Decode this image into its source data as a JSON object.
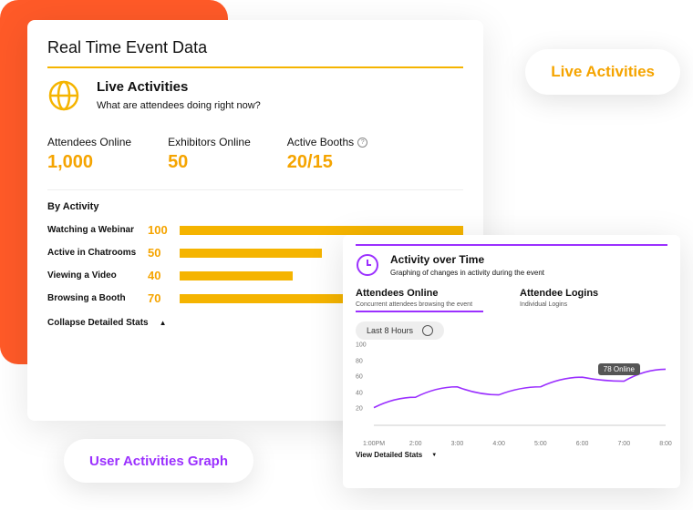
{
  "main": {
    "title": "Real Time Event Data",
    "live_title": "Live Activities",
    "live_sub": "What are attendees doing right now?",
    "stats": [
      {
        "label": "Attendees Online",
        "value": "1,000"
      },
      {
        "label": "Exhibitors Online",
        "value": "50"
      },
      {
        "label": "Active Booths",
        "value": "20/15"
      }
    ],
    "by_activity_label": "By Activity",
    "activities": [
      {
        "name": "Watching a Webinar",
        "value": "100",
        "pct": 100
      },
      {
        "name": "Active in Chatrooms",
        "value": "50",
        "pct": 50
      },
      {
        "name": "Viewing a Video",
        "value": "40",
        "pct": 40
      },
      {
        "name": "Browsing a Booth",
        "value": "70",
        "pct": 70
      }
    ],
    "collapse": "Collapse Detailed Stats"
  },
  "pill_la": "Live Activities",
  "pill_uag": "User Activities Graph",
  "aot": {
    "title": "Activity over Time",
    "sub": "Graphing of changes in activity during the event",
    "col1_t": "Attendees Online",
    "col1_s": "Concurrent attendees browsing the event",
    "col2_t": "Attendee Logins",
    "col2_s": "Individual Logins",
    "range": "Last 8 Hours",
    "tooltip": "78 Online",
    "view": "View Detailed Stats"
  },
  "chart_data": {
    "type": "line",
    "title": "Attendees Online",
    "xlabel": "",
    "ylabel": "",
    "ylim": [
      0,
      100
    ],
    "x": [
      "1:00PM",
      "2:00",
      "3:00",
      "4:00",
      "5:00",
      "6:00",
      "7:00",
      "8:00"
    ],
    "values": [
      22,
      35,
      48,
      38,
      48,
      60,
      55,
      70
    ],
    "yticks": [
      20,
      40,
      60,
      80,
      100
    ]
  }
}
